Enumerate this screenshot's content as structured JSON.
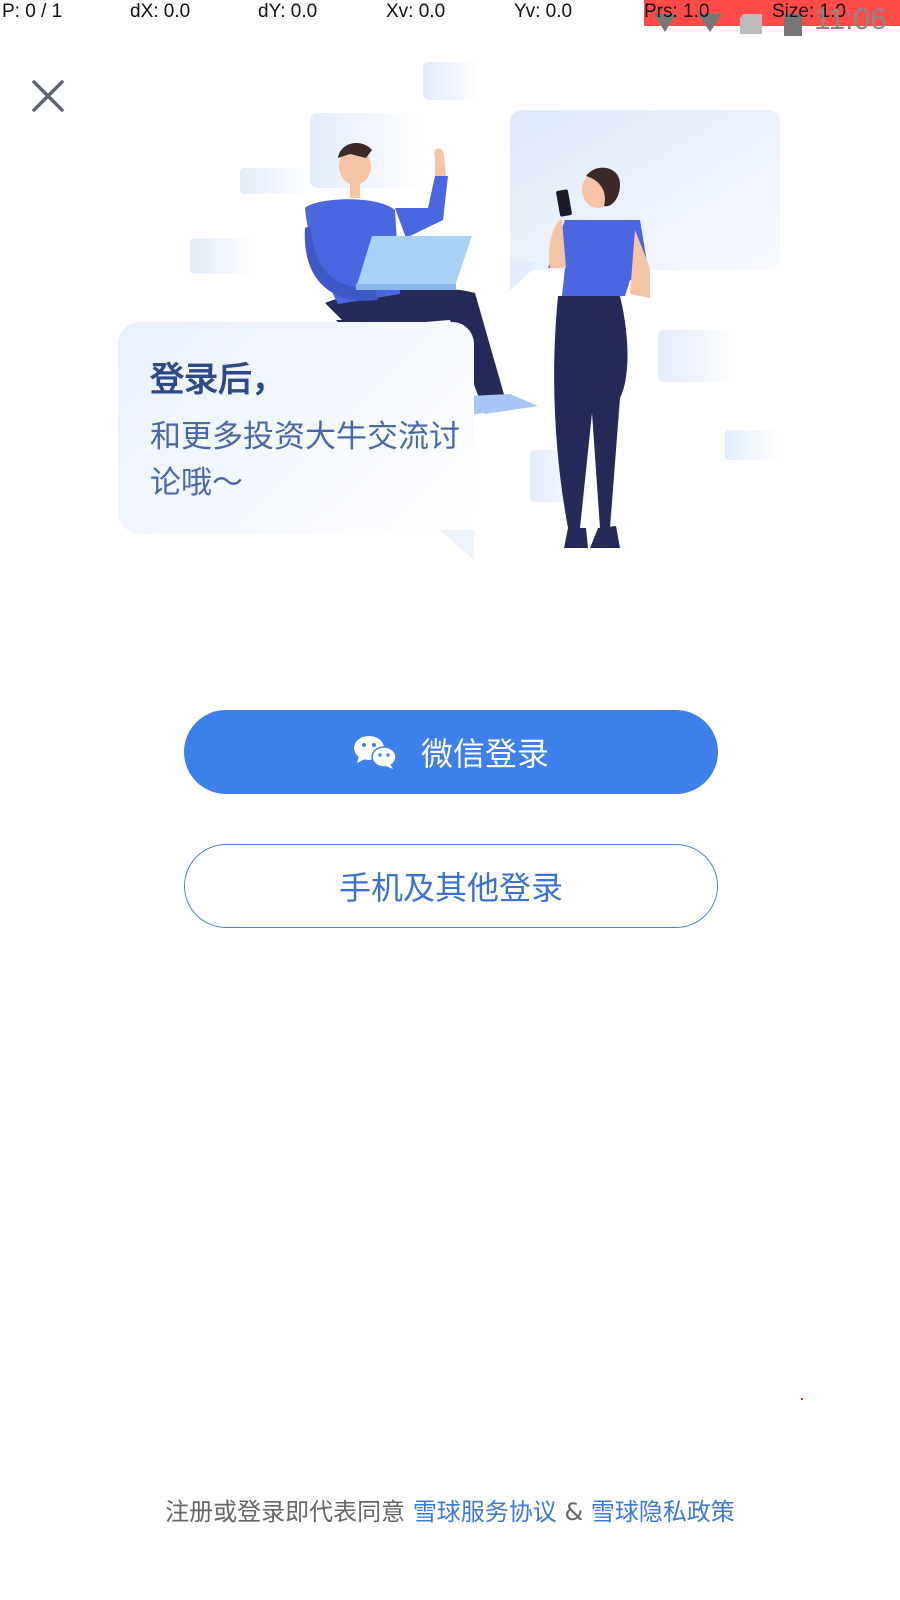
{
  "status_bar": {
    "pointer": "P: 0 / 1",
    "dx": "dX: 0.0",
    "dy": "dY: 0.0",
    "xv": "Xv: 0.0",
    "yv": "Yv: 0.0",
    "prs": "Prs: 1.0",
    "size": "Size: 1.0",
    "time": "11:06",
    "highlight_color": "#ff4a4a"
  },
  "close_icon": "close-icon",
  "hero": {
    "title": "登录后，",
    "body": "和更多投资大牛交流讨论哦～"
  },
  "buttons": {
    "wechat_label": "微信登录",
    "wechat_icon": "wechat-icon",
    "phone_label": "手机及其他登录"
  },
  "footer": {
    "prefix": "注册或登录即代表同意",
    "service_link": "雪球服务协议",
    "amp": "&",
    "privacy_link": "雪球隐私政策"
  },
  "colors": {
    "primary": "#3d80ec",
    "link": "#3d7ad6",
    "title": "#2c4a86"
  }
}
